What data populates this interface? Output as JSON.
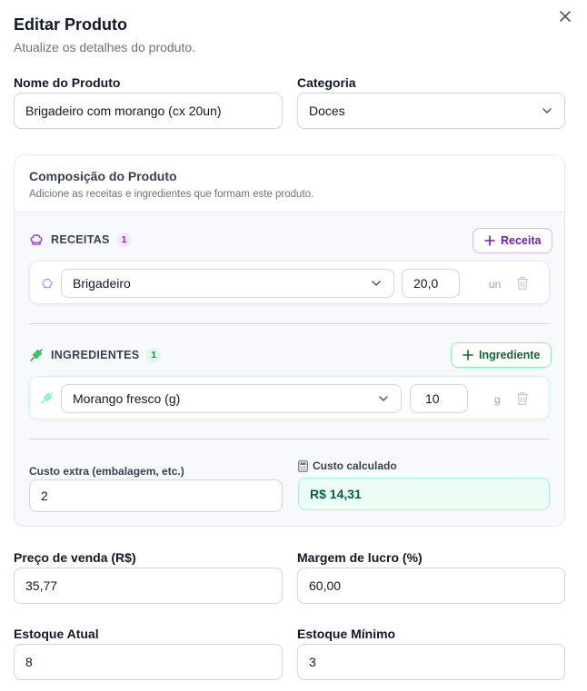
{
  "dialog": {
    "title": "Editar Produto",
    "subtitle": "Atualize os detalhes do produto."
  },
  "form": {
    "name_label": "Nome do Produto",
    "name_value": "Brigadeiro com morango (cx 20un)",
    "category_label": "Categoria",
    "category_value": "Doces",
    "price_label": "Preço de venda (R$)",
    "price_value": "35,77",
    "margin_label": "Margem de lucro (%)",
    "margin_value": "60,00",
    "stock_label": "Estoque Atual",
    "stock_value": "8",
    "min_stock_label": "Estoque Mínimo",
    "min_stock_value": "3"
  },
  "composition": {
    "title": "Composição do Produto",
    "subtitle": "Adicione as receitas e ingredientes que formam este produto.",
    "recipes": {
      "label": "RECEITAS",
      "count": "1",
      "add_label": "Receita",
      "items": [
        {
          "name": "Brigadeiro",
          "quantity": "20,0",
          "unit": "un"
        }
      ]
    },
    "ingredients": {
      "label": "INGREDIENTES",
      "count": "1",
      "add_label": "Ingrediente",
      "items": [
        {
          "name": "Morango fresco (g)",
          "quantity": "10",
          "unit": "g"
        }
      ]
    },
    "extra_cost_label": "Custo extra (embalagem, etc.)",
    "extra_cost_value": "2",
    "calc_cost_label": "Custo calculado",
    "calc_cost_value": "R$ 14,31"
  },
  "colors": {
    "recipe_accent": "#7e22ce",
    "ingredient_accent": "#16a34a",
    "calc_bg": "#ecfdf5"
  },
  "icons": {
    "close": "close-icon",
    "recipe": "chef-hat-icon",
    "ingredient": "wheat-icon",
    "delete": "trash-icon",
    "calculator": "calculator-icon",
    "add": "plus-icon",
    "dropdown": "chevron-down-icon"
  }
}
